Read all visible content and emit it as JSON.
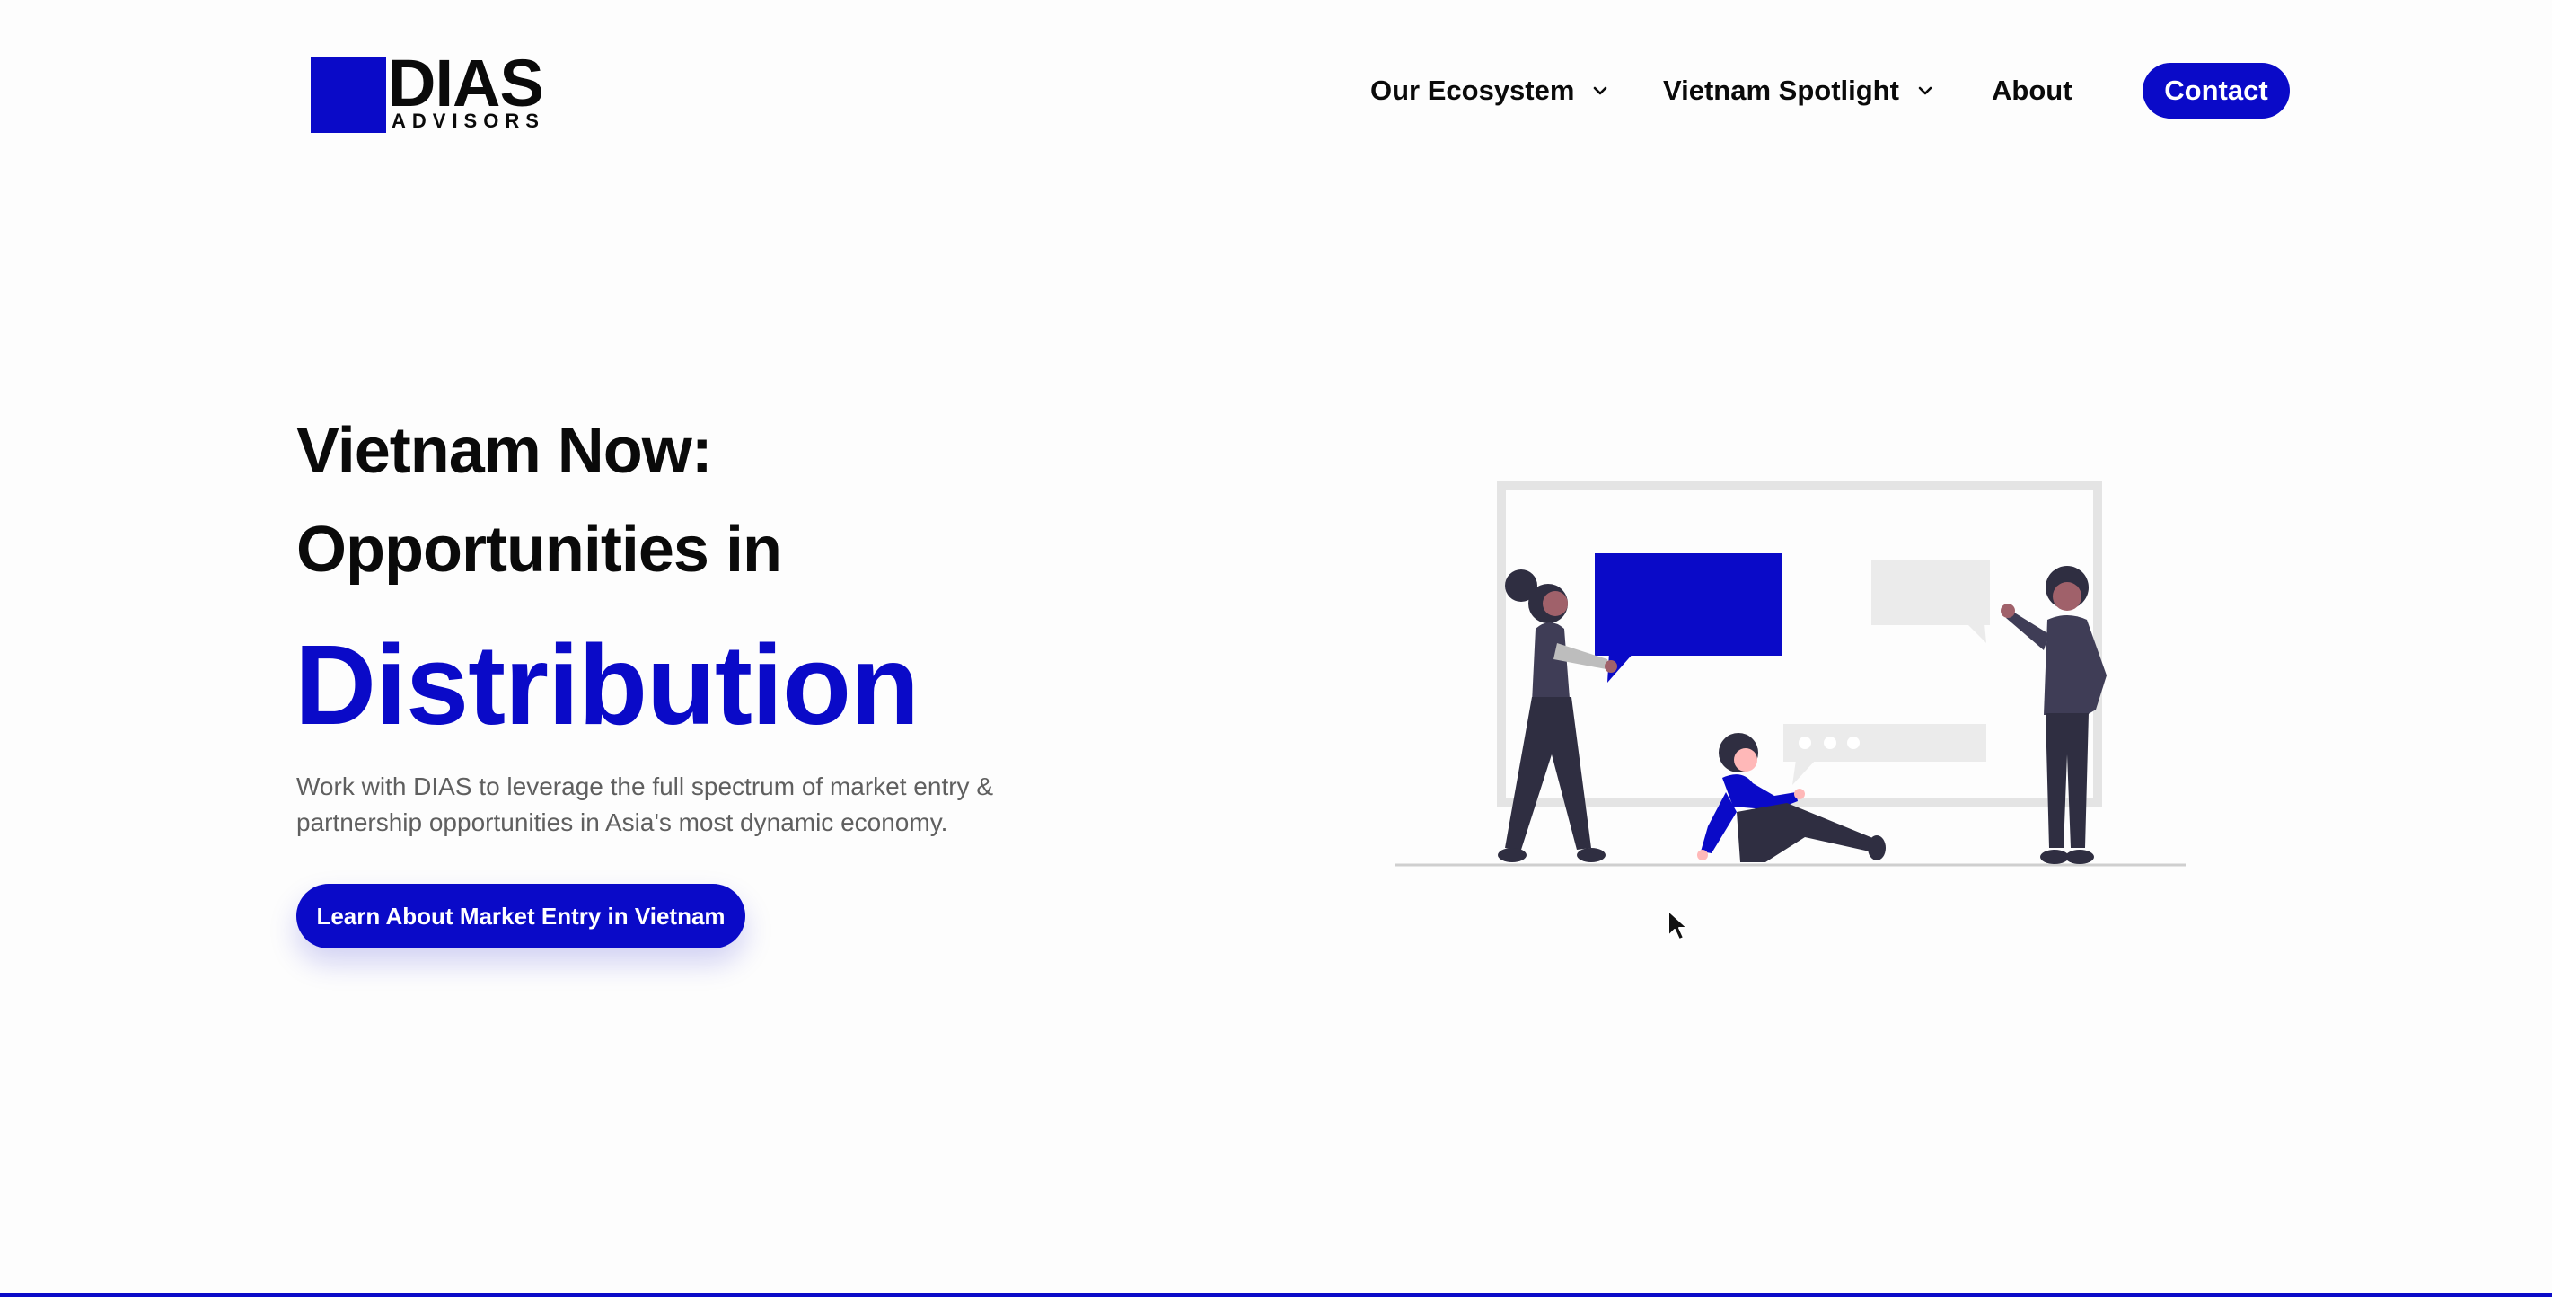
{
  "brand": {
    "name": "DIAS",
    "sub": "ADVISORS",
    "accent_color": "#0a0ac8"
  },
  "nav": {
    "items": [
      {
        "label": "Our Ecosystem",
        "has_dropdown": true,
        "icon": "chevron-down-icon"
      },
      {
        "label": "Vietnam Spotlight",
        "has_dropdown": true,
        "icon": "chevron-down-icon"
      },
      {
        "label": "About",
        "has_dropdown": false
      }
    ],
    "contact_label": "Contact"
  },
  "hero": {
    "title_line1": "Vietnam Now:",
    "title_line2": "Opportunities in",
    "highlight": "Distribution",
    "description": "Work with DIAS to leverage the full spectrum of market entry & partnership opportunities in Asia's most dynamic economy.",
    "cta_label": "Learn About Market Entry in Vietnam"
  },
  "illustration": {
    "icon": "team-presentation-illustration"
  }
}
